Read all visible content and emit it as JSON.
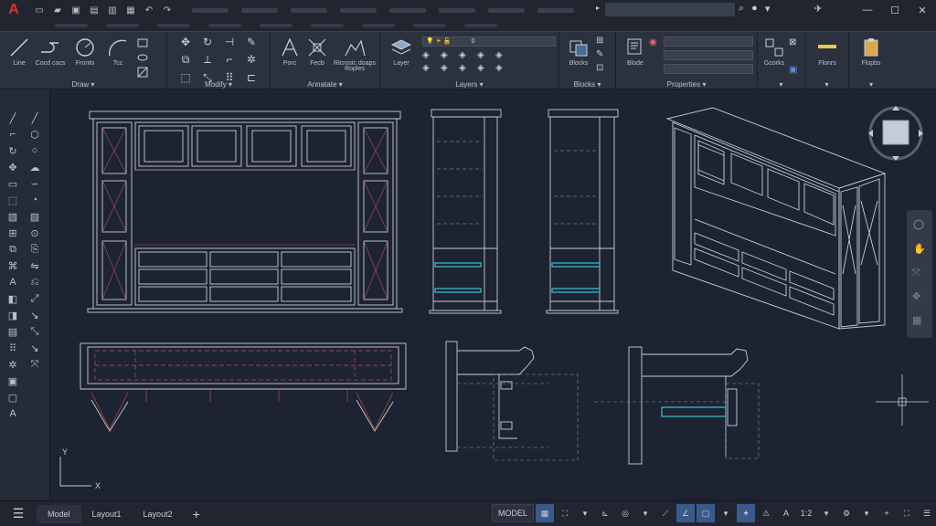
{
  "app": {
    "logo": "A"
  },
  "quick_access": {
    "icons": [
      "new-icon",
      "open-icon",
      "save-icon",
      "saveas-icon",
      "print-icon",
      "plot-icon",
      "undo-icon",
      "redo-icon"
    ]
  },
  "ribbon": {
    "draw": {
      "title": "Draw",
      "line": "Line",
      "polyline": "Cocd cocs",
      "circle": "Fronto",
      "arc": "Tcc"
    },
    "modify": {
      "title": "Modify"
    },
    "annotate": {
      "title": "Annatate",
      "text": "Porc",
      "dimension": "Fecb",
      "multileader": "Rlcrosic doaps",
      "multileader2": "Roples"
    },
    "layers": {
      "title": "Layers",
      "layer_props": "Layer",
      "current_layer": "0"
    },
    "blocks": {
      "title": "Blocks",
      "block": "Blocks"
    },
    "properties": {
      "title": "Properties",
      "match": "Blode"
    },
    "groups": {
      "label": "Gcorks"
    },
    "utilities": {
      "label": "Flonrs"
    },
    "clipboard": {
      "label": "Flopbs"
    }
  },
  "statusbar": {
    "tabs": [
      "Model",
      "Layout1",
      "Layout2"
    ],
    "model_btn": "MODEL",
    "scale": "1:2"
  },
  "colors": {
    "accent": "#e0312b",
    "canvas": "#1e2332",
    "lines": "#c6ccd6",
    "magenta": "#b04a8a",
    "cyan": "#37c4d6",
    "green": "#3aa04a"
  }
}
